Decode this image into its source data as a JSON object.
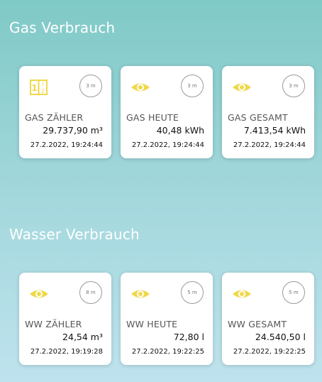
{
  "sections": [
    {
      "title": "Gas Verbrauch",
      "cards": [
        {
          "icon": "meter-counter-icon",
          "badge": "3 m",
          "label": "GAS ZÄHLER",
          "value": "29.737,90 m³",
          "timestamp": "27.2.2022, 19:24:44"
        },
        {
          "icon": "eye-icon",
          "badge": "3 m",
          "label": "GAS HEUTE",
          "value": "40,48 kWh",
          "timestamp": "27.2.2022, 19:24:44"
        },
        {
          "icon": "eye-icon",
          "badge": "3 m",
          "label": "GAS GESAMT",
          "value": "7.413,54 kWh",
          "timestamp": "27.2.2022, 19:24:44"
        }
      ]
    },
    {
      "title": "Wasser Verbrauch",
      "cards": [
        {
          "icon": "eye-icon",
          "badge": "8 m",
          "label": "WW ZÄHLER",
          "value": "24,54 m³",
          "timestamp": "27.2.2022, 19:19:28"
        },
        {
          "icon": "eye-icon",
          "badge": "5 m",
          "label": "WW HEUTE",
          "value": "72,80 l",
          "timestamp": "27.2.2022, 19:22:25"
        },
        {
          "icon": "eye-icon",
          "badge": "5 m",
          "label": "WW GESAMT",
          "value": "24.540,50 l",
          "timestamp": "27.2.2022, 19:22:25"
        }
      ]
    }
  ],
  "colors": {
    "icon": "#f0d84a",
    "title": "#ffffff"
  }
}
